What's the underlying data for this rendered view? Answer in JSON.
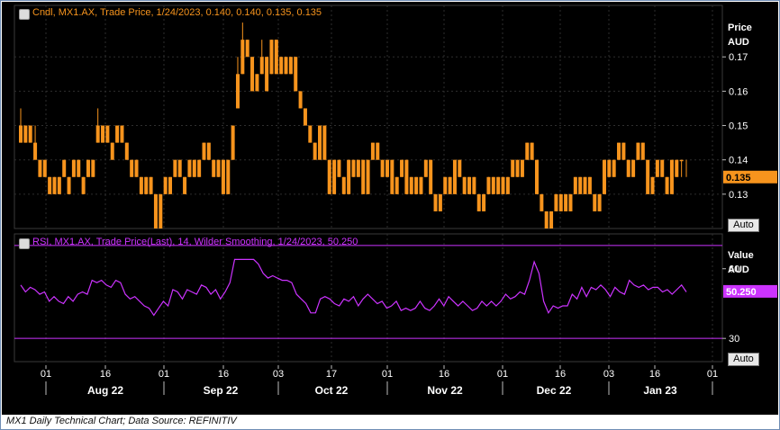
{
  "price_panel": {
    "legend": "Cndl, MX1.AX, Trade Price,  1/24/2023, 0.140, 0.140, 0.135, 0.135",
    "axis_title_line1": "Price",
    "axis_title_line2": "AUD",
    "auto_label": "Auto",
    "last_value_label": "0.135"
  },
  "rsi_panel": {
    "legend": "RSI, MX1.AX, Trade Price(Last),  14, Wilder Smoothing,  1/24/2023, 50.250",
    "axis_title_line1": "Value",
    "axis_title_line2": "AUD",
    "auto_label": "Auto",
    "last_value_label": "50.250"
  },
  "caption": "MX1 Daily Technical Chart; Data Source: REFINITIV",
  "colors": {
    "background": "#000000",
    "candle": "#f7941d",
    "rsi": "#cc33ff",
    "grid": "#2e2e2e",
    "text": "#ffffff"
  },
  "chart_data": [
    {
      "type": "candlestick",
      "title": "Cndl, MX1.AX, Trade Price,  1/24/2023, 0.140, 0.140, 0.135, 0.135",
      "ylabel": "Price AUD",
      "ylim": [
        0.12,
        0.185
      ],
      "yticks": [
        0.13,
        0.14,
        0.15,
        0.16,
        0.17
      ],
      "x_tick_labels": [
        "01",
        "16",
        "01",
        "16",
        "03",
        "17",
        "01",
        "16",
        "01",
        "16",
        "03",
        "16",
        "01"
      ],
      "month_labels": [
        "Aug 22",
        "Sep 22",
        "Oct 22",
        "Nov 22",
        "Dec 22",
        "Jan 23"
      ],
      "last": 0.135,
      "close": [
        0.15,
        0.145,
        0.15,
        0.14,
        0.135,
        0.14,
        0.13,
        0.135,
        0.13,
        0.14,
        0.13,
        0.135,
        0.14,
        0.13,
        0.14,
        0.135,
        0.15,
        0.145,
        0.15,
        0.14,
        0.145,
        0.15,
        0.14,
        0.135,
        0.14,
        0.13,
        0.135,
        0.13,
        0.12,
        0.13,
        0.135,
        0.13,
        0.14,
        0.135,
        0.13,
        0.14,
        0.135,
        0.14,
        0.145,
        0.14,
        0.135,
        0.14,
        0.13,
        0.14,
        0.15,
        0.165,
        0.175,
        0.17,
        0.16,
        0.165,
        0.17,
        0.16,
        0.175,
        0.165,
        0.17,
        0.165,
        0.17,
        0.16,
        0.155,
        0.15,
        0.145,
        0.14,
        0.15,
        0.14,
        0.13,
        0.14,
        0.135,
        0.13,
        0.14,
        0.135,
        0.14,
        0.13,
        0.14,
        0.145,
        0.14,
        0.135,
        0.14,
        0.13,
        0.135,
        0.14,
        0.13,
        0.135,
        0.13,
        0.135,
        0.14,
        0.13,
        0.125,
        0.13,
        0.135,
        0.13,
        0.14,
        0.135,
        0.13,
        0.135,
        0.13,
        0.125,
        0.13,
        0.135,
        0.13,
        0.135,
        0.13,
        0.135,
        0.14,
        0.135,
        0.14,
        0.145,
        0.14,
        0.13,
        0.125,
        0.12,
        0.125,
        0.13,
        0.125,
        0.13,
        0.13,
        0.135,
        0.13,
        0.135,
        0.13,
        0.125,
        0.13,
        0.14,
        0.135,
        0.14,
        0.145,
        0.14,
        0.135,
        0.14,
        0.145,
        0.14,
        0.13,
        0.135,
        0.14,
        0.135,
        0.13,
        0.14,
        0.135,
        0.14,
        0.135
      ],
      "open": [
        0.145,
        0.15,
        0.145,
        0.145,
        0.14,
        0.135,
        0.135,
        0.13,
        0.135,
        0.135,
        0.135,
        0.14,
        0.135,
        0.135,
        0.135,
        0.14,
        0.145,
        0.15,
        0.145,
        0.145,
        0.15,
        0.145,
        0.145,
        0.14,
        0.135,
        0.135,
        0.13,
        0.135,
        0.13,
        0.12,
        0.13,
        0.135,
        0.135,
        0.14,
        0.135,
        0.135,
        0.14,
        0.135,
        0.14,
        0.145,
        0.14,
        0.135,
        0.14,
        0.13,
        0.14,
        0.155,
        0.165,
        0.175,
        0.17,
        0.16,
        0.165,
        0.17,
        0.165,
        0.175,
        0.165,
        0.17,
        0.165,
        0.17,
        0.16,
        0.155,
        0.15,
        0.145,
        0.14,
        0.15,
        0.14,
        0.13,
        0.14,
        0.135,
        0.13,
        0.14,
        0.135,
        0.14,
        0.13,
        0.14,
        0.145,
        0.14,
        0.135,
        0.14,
        0.13,
        0.135,
        0.14,
        0.13,
        0.135,
        0.13,
        0.135,
        0.14,
        0.13,
        0.125,
        0.13,
        0.135,
        0.13,
        0.14,
        0.135,
        0.13,
        0.135,
        0.13,
        0.125,
        0.13,
        0.135,
        0.13,
        0.135,
        0.13,
        0.135,
        0.14,
        0.135,
        0.14,
        0.145,
        0.14,
        0.13,
        0.125,
        0.12,
        0.125,
        0.13,
        0.125,
        0.125,
        0.13,
        0.135,
        0.13,
        0.135,
        0.13,
        0.125,
        0.13,
        0.14,
        0.135,
        0.14,
        0.145,
        0.14,
        0.135,
        0.14,
        0.145,
        0.14,
        0.13,
        0.135,
        0.14,
        0.135,
        0.13,
        0.14,
        0.14
      ],
      "high": [
        0.155,
        0.15,
        0.15,
        0.15,
        0.14,
        0.14,
        0.135,
        0.135,
        0.135,
        0.14,
        0.135,
        0.14,
        0.14,
        0.135,
        0.14,
        0.14,
        0.155,
        0.15,
        0.15,
        0.145,
        0.15,
        0.15,
        0.145,
        0.14,
        0.14,
        0.135,
        0.135,
        0.135,
        0.13,
        0.13,
        0.135,
        0.135,
        0.14,
        0.14,
        0.135,
        0.14,
        0.14,
        0.14,
        0.145,
        0.145,
        0.14,
        0.14,
        0.14,
        0.14,
        0.15,
        0.17,
        0.18,
        0.175,
        0.17,
        0.165,
        0.175,
        0.17,
        0.175,
        0.175,
        0.17,
        0.17,
        0.17,
        0.17,
        0.16,
        0.155,
        0.15,
        0.145,
        0.15,
        0.15,
        0.14,
        0.14,
        0.14,
        0.135,
        0.14,
        0.14,
        0.14,
        0.14,
        0.14,
        0.145,
        0.145,
        0.14,
        0.14,
        0.14,
        0.135,
        0.14,
        0.14,
        0.135,
        0.135,
        0.135,
        0.14,
        0.14,
        0.13,
        0.13,
        0.135,
        0.135,
        0.14,
        0.14,
        0.135,
        0.135,
        0.135,
        0.13,
        0.13,
        0.135,
        0.135,
        0.135,
        0.135,
        0.135,
        0.14,
        0.14,
        0.14,
        0.145,
        0.145,
        0.14,
        0.13,
        0.125,
        0.125,
        0.13,
        0.13,
        0.13,
        0.13,
        0.135,
        0.135,
        0.135,
        0.135,
        0.13,
        0.13,
        0.14,
        0.14,
        0.14,
        0.145,
        0.145,
        0.14,
        0.14,
        0.145,
        0.145,
        0.14,
        0.135,
        0.14,
        0.14,
        0.135,
        0.14,
        0.14,
        0.14,
        0.14
      ],
      "low": [
        0.145,
        0.145,
        0.145,
        0.14,
        0.135,
        0.135,
        0.13,
        0.13,
        0.13,
        0.135,
        0.13,
        0.135,
        0.135,
        0.13,
        0.135,
        0.135,
        0.145,
        0.145,
        0.145,
        0.14,
        0.145,
        0.145,
        0.14,
        0.135,
        0.135,
        0.13,
        0.13,
        0.13,
        0.12,
        0.12,
        0.13,
        0.13,
        0.135,
        0.135,
        0.13,
        0.135,
        0.135,
        0.135,
        0.14,
        0.14,
        0.135,
        0.135,
        0.13,
        0.13,
        0.14,
        0.155,
        0.165,
        0.17,
        0.16,
        0.16,
        0.165,
        0.16,
        0.165,
        0.165,
        0.165,
        0.165,
        0.165,
        0.16,
        0.155,
        0.15,
        0.145,
        0.14,
        0.14,
        0.14,
        0.13,
        0.13,
        0.135,
        0.13,
        0.13,
        0.135,
        0.135,
        0.13,
        0.13,
        0.14,
        0.14,
        0.135,
        0.135,
        0.13,
        0.13,
        0.135,
        0.13,
        0.13,
        0.13,
        0.13,
        0.135,
        0.13,
        0.125,
        0.125,
        0.13,
        0.13,
        0.13,
        0.135,
        0.13,
        0.13,
        0.13,
        0.125,
        0.125,
        0.13,
        0.13,
        0.13,
        0.13,
        0.13,
        0.135,
        0.135,
        0.135,
        0.14,
        0.14,
        0.13,
        0.125,
        0.12,
        0.12,
        0.125,
        0.125,
        0.125,
        0.125,
        0.13,
        0.13,
        0.13,
        0.13,
        0.125,
        0.125,
        0.13,
        0.135,
        0.135,
        0.14,
        0.14,
        0.135,
        0.135,
        0.14,
        0.14,
        0.13,
        0.13,
        0.135,
        0.135,
        0.13,
        0.13,
        0.135,
        0.135,
        0.135
      ]
    },
    {
      "type": "line",
      "title": "RSI, MX1.AX, Trade Price(Last),  14, Wilder Smoothing,  1/24/2023, 50.250",
      "ylabel": "Value AUD",
      "ylim": [
        20,
        75
      ],
      "yticks": [
        30,
        60
      ],
      "reference_lines": [
        70,
        30
      ],
      "last": 50.25,
      "series": [
        {
          "values": [
            53,
            50,
            52,
            51,
            49,
            50,
            46,
            48,
            46,
            45,
            48,
            46,
            49,
            50,
            49,
            55,
            54,
            55,
            53,
            52,
            55,
            54,
            49,
            47,
            48,
            46,
            44,
            43,
            40,
            43,
            46,
            44,
            51,
            50,
            47,
            51,
            50,
            49,
            53,
            52,
            49,
            51,
            47,
            50,
            54,
            64,
            64,
            64,
            64,
            64,
            62,
            58,
            56,
            57,
            56,
            55,
            55,
            54,
            49,
            47,
            45,
            41,
            41,
            47,
            48,
            47,
            45,
            44,
            47,
            46,
            48,
            44,
            47,
            49,
            47,
            45,
            46,
            43,
            44,
            46,
            42,
            43,
            42,
            43,
            46,
            43,
            42,
            44,
            47,
            44,
            48,
            46,
            44,
            46,
            44,
            42,
            43,
            46,
            44,
            46,
            44,
            46,
            49,
            47,
            48,
            50,
            49,
            55,
            63,
            58,
            46,
            41,
            44,
            43,
            44,
            44,
            49,
            47,
            52,
            48,
            52,
            51,
            53,
            51,
            48,
            52,
            50,
            49,
            55,
            53,
            52,
            53,
            51,
            52,
            52,
            50,
            51,
            49,
            51,
            53,
            50
          ]
        }
      ]
    }
  ]
}
